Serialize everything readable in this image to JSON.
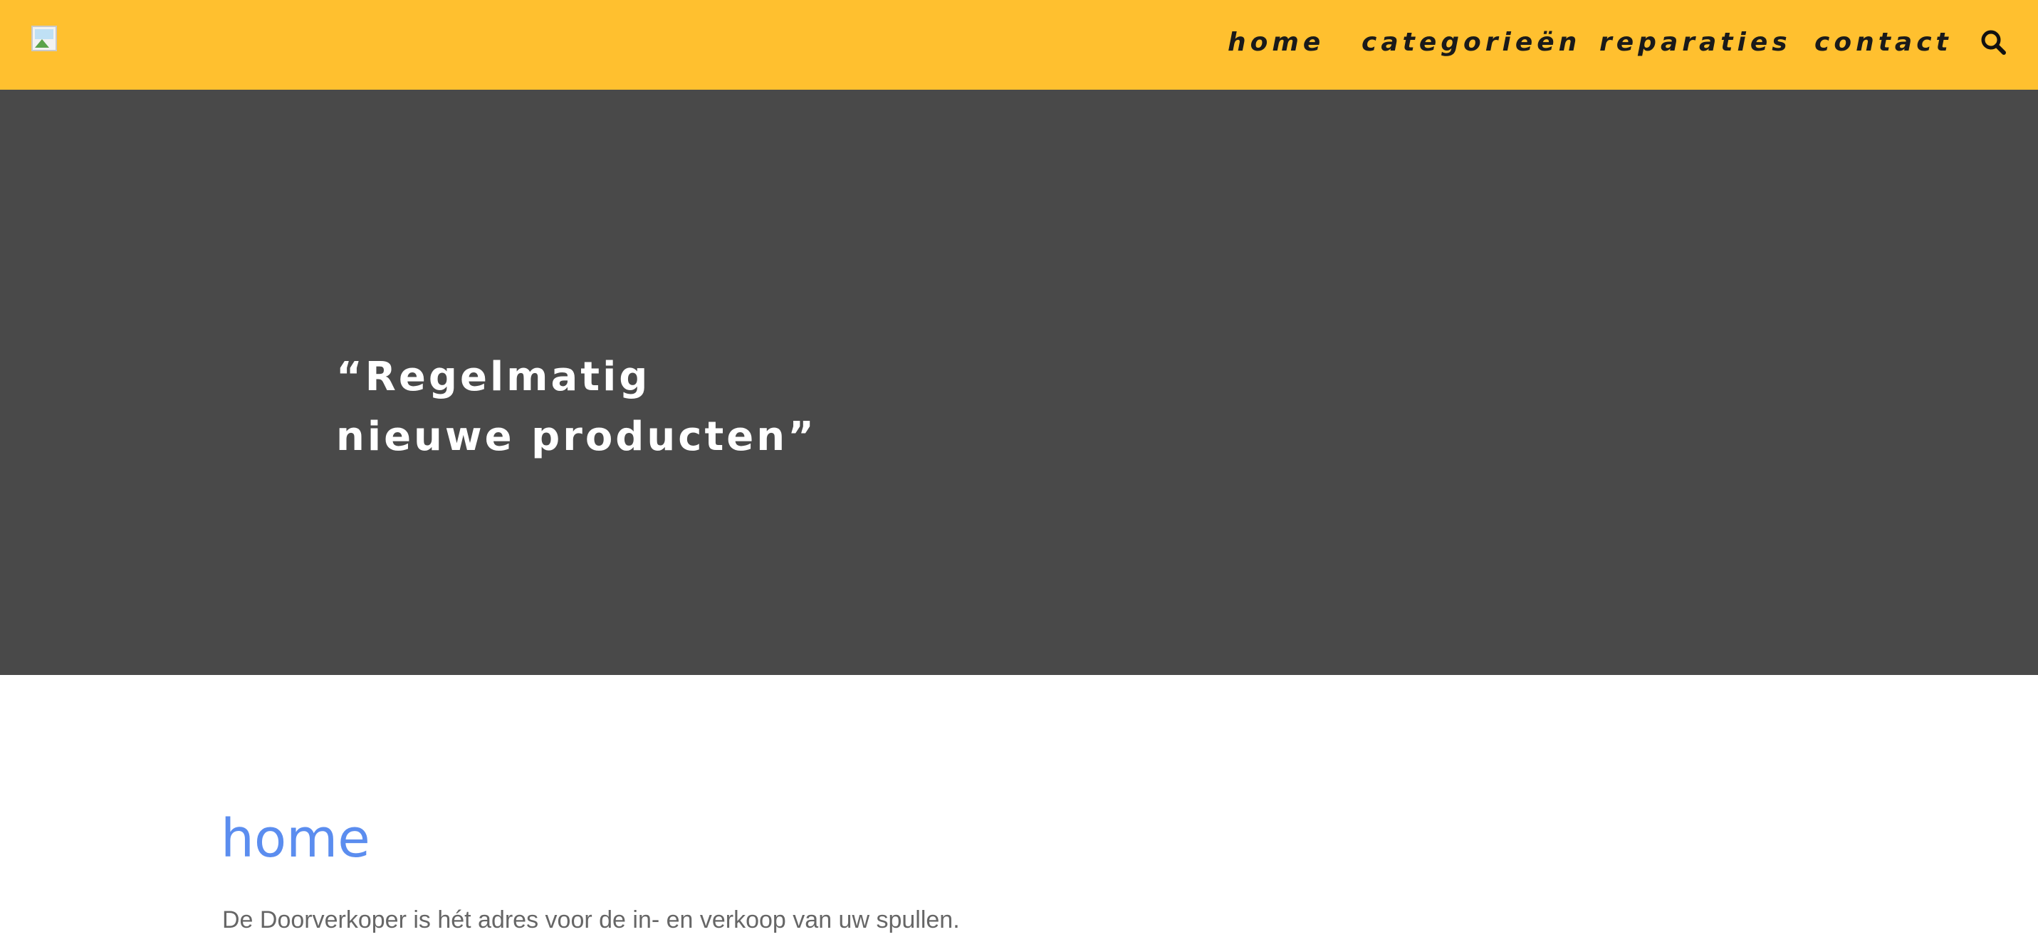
{
  "header": {
    "logo_alt": "logo",
    "nav": [
      {
        "label": "home"
      },
      {
        "label": "categorieën"
      },
      {
        "label": "reparaties"
      },
      {
        "label": "contact"
      }
    ],
    "search_icon": "search-icon"
  },
  "hero": {
    "quote_line1": "“Regelmatig",
    "quote_line2": "nieuwe producten”",
    "background_color": "#494949"
  },
  "main": {
    "title": "home",
    "intro": "De Doorverkoper is hét adres voor de in- en verkoop van uw spullen."
  },
  "colors": {
    "header_bg": "#ffc02f",
    "title_blue": "#5b8def"
  }
}
